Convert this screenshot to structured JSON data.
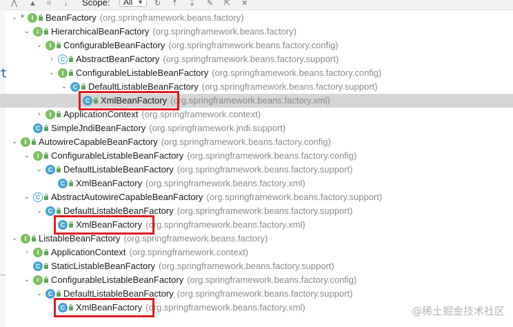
{
  "toolbar": {
    "scope_label": "Scope:",
    "scope_value": "All"
  },
  "tree": [
    {
      "depth": 0,
      "expanded": true,
      "star": true,
      "kind": "interface",
      "name": "BeanFactory",
      "pkg": "(org.springframework.beans.factory)"
    },
    {
      "depth": 1,
      "expanded": true,
      "kind": "interface",
      "name": "HierarchicalBeanFactory",
      "pkg": "(org.springframework.beans.factory)"
    },
    {
      "depth": 2,
      "expanded": true,
      "kind": "interface",
      "name": "ConfigurableBeanFactory",
      "pkg": "(org.springframework.beans.factory.config)"
    },
    {
      "depth": 3,
      "expanded": false,
      "kind": "abstract",
      "name": "AbstractBeanFactory",
      "pkg": "(org.springframework.beans.factory.support)"
    },
    {
      "depth": 3,
      "expanded": true,
      "kind": "interface",
      "name": "ConfigurableListableBeanFactory",
      "pkg": "(org.springframework.beans.factory.config)"
    },
    {
      "depth": 4,
      "expanded": true,
      "kind": "class",
      "name": "DefaultListableBeanFactory",
      "pkg": "(org.springframework.beans.factory.support)"
    },
    {
      "depth": 5,
      "kind": "class",
      "name": "XmlBeanFactory",
      "pkg": "(org.springframework.beans.factory.xml)",
      "selected": true,
      "highlight": true
    },
    {
      "depth": 2,
      "expanded": false,
      "kind": "interface",
      "name": "ApplicationContext",
      "pkg": "(org.springframework.context)"
    },
    {
      "depth": 1,
      "kind": "class",
      "name": "SimpleJndiBeanFactory",
      "pkg": "(org.springframework.jndi.support)"
    },
    {
      "depth": 0,
      "expanded": true,
      "kind": "interface",
      "name": "AutowireCapableBeanFactory",
      "pkg": "(org.springframework.beans.factory.config)"
    },
    {
      "depth": 1,
      "expanded": true,
      "kind": "interface",
      "name": "ConfigurableListableBeanFactory",
      "pkg": "(org.springframework.beans.factory.config)"
    },
    {
      "depth": 2,
      "expanded": true,
      "kind": "class",
      "name": "DefaultListableBeanFactory",
      "pkg": "(org.springframework.beans.factory.support)"
    },
    {
      "depth": 3,
      "kind": "class",
      "name": "XmlBeanFactory",
      "pkg": "(org.springframework.beans.factory.xml)"
    },
    {
      "depth": 1,
      "expanded": true,
      "kind": "abstract",
      "name": "AbstractAutowireCapableBeanFactory",
      "pkg": "(org.springframework.beans.factory.support)"
    },
    {
      "depth": 2,
      "expanded": true,
      "kind": "class",
      "name": "DefaultListableBeanFactory",
      "pkg": "(org.springframework.beans.factory.support)"
    },
    {
      "depth": 3,
      "kind": "class",
      "name": "XmlBeanFactory",
      "pkg": "(org.springframework.beans.factory.xml)",
      "highlight": true
    },
    {
      "depth": 0,
      "expanded": true,
      "kind": "interface",
      "name": "ListableBeanFactory",
      "pkg": "(org.springframework.beans.factory)"
    },
    {
      "depth": 1,
      "expanded": false,
      "kind": "interface",
      "name": "ApplicationContext",
      "pkg": "(org.springframework.context)"
    },
    {
      "depth": 1,
      "kind": "class",
      "name": "StaticListableBeanFactory",
      "pkg": "(org.springframework.beans.factory.support)"
    },
    {
      "depth": 1,
      "expanded": true,
      "kind": "interface",
      "name": "ConfigurableListableBeanFactory",
      "pkg": "(org.springframework.beans.factory.config)"
    },
    {
      "depth": 2,
      "expanded": true,
      "kind": "class",
      "name": "DefaultListableBeanFactory",
      "pkg": "(org.springframework.beans.factory.support)"
    },
    {
      "depth": 3,
      "kind": "class",
      "name": "XmlBeanFactory",
      "pkg": "(org.springframework.beans.factory.xml)",
      "highlight": true
    }
  ],
  "watermark": "@稀土掘金技术社区",
  "colors": {
    "interface_icon": "#7fbf63",
    "class_icon": "#4aa3d1",
    "highlight_box": "#e0191f",
    "selected_row": "#d5d5d5",
    "package_text": "#8a8a8a"
  }
}
